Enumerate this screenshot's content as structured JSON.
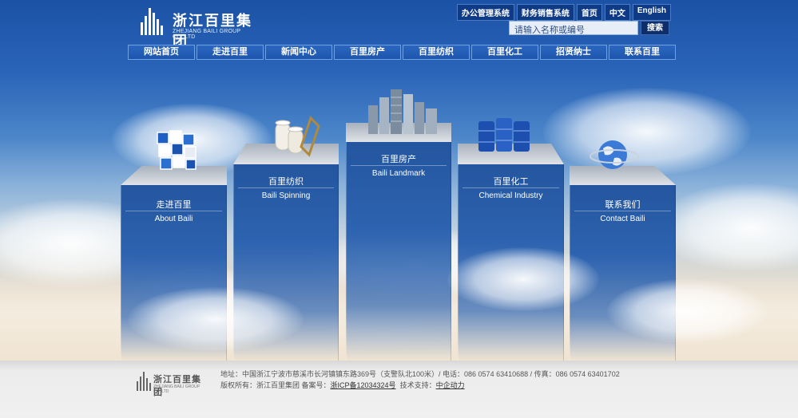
{
  "brand": {
    "name_cn": "浙江百里集团",
    "name_en": "ZHEJIANG BAILI GROUP CO.,LTD"
  },
  "top_links": [
    "办公管理系统",
    "财务销售系统",
    "首页",
    "中文",
    "English"
  ],
  "search": {
    "placeholder": "请输入名称或编号",
    "button": "搜索"
  },
  "nav": [
    "网站首页",
    "走进百里",
    "新闻中心",
    "百里房产",
    "百里纺织",
    "百里化工",
    "招贤纳士",
    "联系百里"
  ],
  "pillars": [
    {
      "cn": "走进百里",
      "en": "About Baili",
      "icon": "cubes-icon"
    },
    {
      "cn": "百里纺织",
      "en": "Baili Spinning",
      "icon": "yarn-spools-icon"
    },
    {
      "cn": "百里房产",
      "en": "Baili Landmark",
      "icon": "buildings-icon"
    },
    {
      "cn": "百里化工",
      "en": "Chemical Industry",
      "icon": "barrels-icon"
    },
    {
      "cn": "联系我们",
      "en": "Contact Baili",
      "icon": "globe-icon"
    }
  ],
  "footer": {
    "address": "地址：中国浙江宁波市慈溪市长河镇镇东路369号（支警队北100米）/ 电话：086 0574 63410688 / 传真：086 0574 63401702",
    "rights_prefix": "版权所有：浙江百里集团  备案号：",
    "icp": "浙ICP备12034324号",
    "tech_prefix": "  技术支持：",
    "tech": "中企动力"
  },
  "colors": {
    "nav_bg": "#1e56ae",
    "pillar_blue": "#2d63b0",
    "toplink_bg": "#0f3a86"
  }
}
